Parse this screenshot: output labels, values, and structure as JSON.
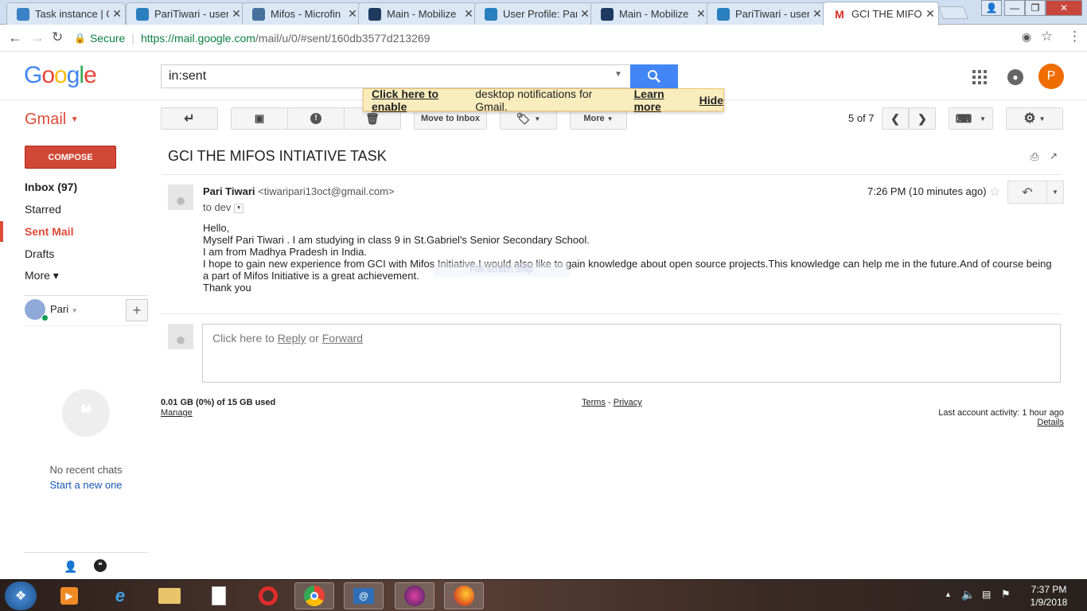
{
  "browser": {
    "tabs": [
      {
        "title": "Task instance | G",
        "icon": "gear-icon",
        "color": "#3b82c6"
      },
      {
        "title": "PariTiwari - user",
        "icon": "globe-icon",
        "color": "#2a7fbf"
      },
      {
        "title": "Mifos - Microfin",
        "icon": "sf-icon",
        "color": "#45719c"
      },
      {
        "title": "Main - Mobilize",
        "icon": "mobilize-icon",
        "color": "#1e3a5f"
      },
      {
        "title": "User Profile: Par",
        "icon": "globe-icon",
        "color": "#2a7fbf"
      },
      {
        "title": "Main - Mobilize",
        "icon": "mobilize-icon",
        "color": "#1e3a5f"
      },
      {
        "title": "PariTiwari - user",
        "icon": "globe-icon",
        "color": "#2a7fbf"
      },
      {
        "title": "GCI THE MIFOS",
        "icon": "gmail-icon",
        "color": "#d93025"
      }
    ],
    "secure_label": "Secure",
    "url_host": "https://mail.google.com",
    "url_path": "/mail/u/0/#sent/160db3577d213269"
  },
  "gmail": {
    "logo_letters": [
      "G",
      "o",
      "o",
      "g",
      "l",
      "e"
    ],
    "logo_colors": [
      "#4285f4",
      "#ea4335",
      "#fbbc05",
      "#4285f4",
      "#34a853",
      "#ea4335"
    ],
    "search_value": "in:sent",
    "avatar_letter": "P",
    "brand_label": "Gmail",
    "notification": {
      "link1": "Click here to enable",
      "text": " desktop notifications for Gmail.",
      "link2": "Learn more",
      "hide": "Hide"
    },
    "toolbar": {
      "move_to_inbox": "Move to Inbox",
      "more": "More",
      "pagination": "5 of 7"
    },
    "compose": "COMPOSE",
    "nav": [
      {
        "label": "Inbox (97)",
        "bold": true
      },
      {
        "label": "Starred"
      },
      {
        "label": "Sent Mail",
        "active": true
      },
      {
        "label": "Drafts"
      },
      {
        "label": "More"
      }
    ],
    "hangouts_user": "Pari",
    "no_chats": "No recent chats",
    "start_new": "Start a new one"
  },
  "email": {
    "subject": "GCI THE MIFOS INTIATIVE TASK",
    "sender_name": "Pari Tiwari",
    "sender_email": "<tiwaripari13oct@gmail.com>",
    "to": "to dev",
    "time": "7:26 PM (10 minutes ago)",
    "body": [
      "Hello,",
      "Myself Pari Tiwari . I am studying in class 9 in St.Gabriel's Senior Secondary School.",
      "I am from Madhya Pradesh  in India.",
      "I hope to gain new experience from GCI with Mifos Initiative.I would also like to gain knowledge about open source projects.This knowledge can help me in the future.And of course being a part of Mifos Initiative is a great   achievement.",
      "Thank you"
    ],
    "reply_prefix": "Click here to ",
    "reply_link": "Reply",
    "reply_or": " or ",
    "forward_link": "Forward",
    "watermark": "Full-screen Snip"
  },
  "footer": {
    "storage": "0.01 GB (0%) of 15 GB used",
    "manage": "Manage",
    "terms": "Terms",
    "sep": " - ",
    "privacy": "Privacy",
    "activity": "Last account activity: 1 hour ago",
    "details": "Details"
  },
  "taskbar": {
    "time": "7:37 PM",
    "date": "1/9/2018"
  }
}
